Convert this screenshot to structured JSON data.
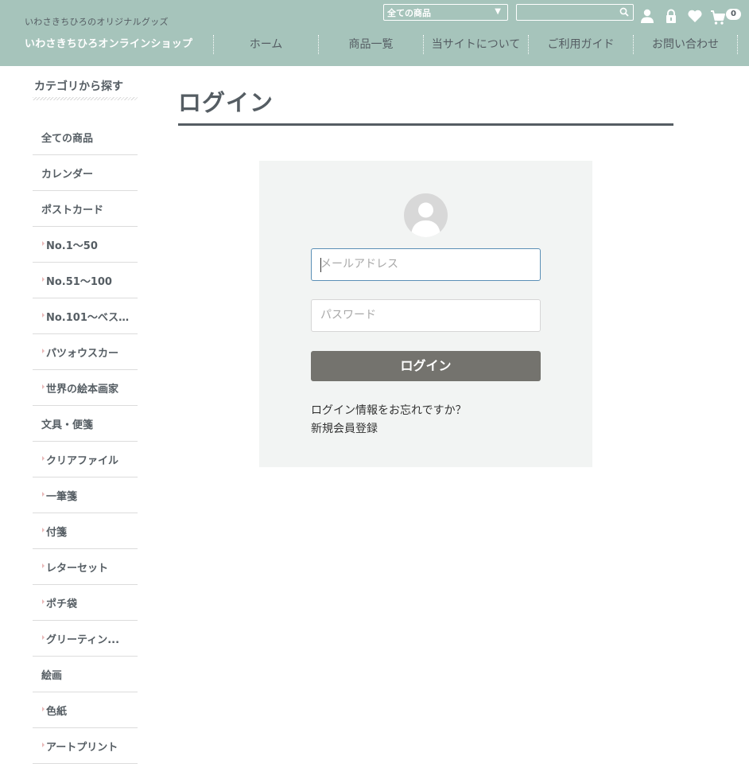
{
  "header": {
    "tagline": "いわさきちひろのオリジナルグッズ",
    "shop_name": "いわさきちひろオンラインショップ",
    "category_select": "全ての商品",
    "search_value": "",
    "cart_count": "0",
    "colors": {
      "header_bg": "#a6c4bb",
      "text": "#555d63"
    }
  },
  "nav": {
    "items": [
      "ホーム",
      "商品一覧",
      "当サイトについて",
      "ご利用ガイド",
      "お問い合わせ"
    ]
  },
  "sidebar": {
    "heading": "カテゴリから探す",
    "items": [
      {
        "label": "全ての商品",
        "sub": false
      },
      {
        "label": "カレンダー",
        "sub": false
      },
      {
        "label": "ポストカード",
        "sub": false
      },
      {
        "label": "No.1〜50",
        "sub": true
      },
      {
        "label": "No.51〜100",
        "sub": true
      },
      {
        "label": "No.101〜ベス...",
        "sub": true
      },
      {
        "label": "パツォウスカー",
        "sub": true
      },
      {
        "label": "世界の絵本画家",
        "sub": true
      },
      {
        "label": "文具・便箋",
        "sub": false
      },
      {
        "label": "クリアファイル",
        "sub": true
      },
      {
        "label": "一筆箋",
        "sub": true
      },
      {
        "label": "付箋",
        "sub": true
      },
      {
        "label": "レターセット",
        "sub": true
      },
      {
        "label": "ポチ袋",
        "sub": true
      },
      {
        "label": "グリーティン...",
        "sub": true
      },
      {
        "label": "絵画",
        "sub": false
      },
      {
        "label": "色紙",
        "sub": true
      },
      {
        "label": "アートプリント",
        "sub": true
      }
    ]
  },
  "main": {
    "title": "ログイン",
    "email_placeholder": "メールアドレス",
    "email_value": "",
    "password_placeholder": "パスワード",
    "password_value": "",
    "login_button": "ログイン",
    "forgot_link": "ログイン情報をお忘れですか？",
    "register_link": "新規会員登録",
    "colors": {
      "login_button": "#74736e",
      "box_bg": "#f2f4f3"
    }
  }
}
